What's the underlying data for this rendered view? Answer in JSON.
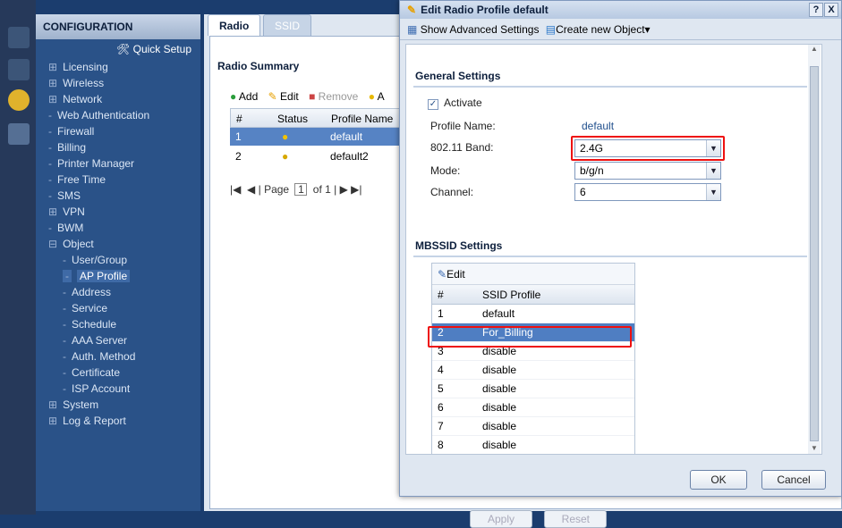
{
  "nav": {
    "header": "CONFIGURATION",
    "quick_setup": "Quick Setup",
    "items": [
      {
        "label": "Licensing",
        "prefix": "⊞"
      },
      {
        "label": "Wireless",
        "prefix": "⊞"
      },
      {
        "label": "Network",
        "prefix": "⊞"
      },
      {
        "label": "Web Authentication",
        "prefix": "-"
      },
      {
        "label": "Firewall",
        "prefix": "-"
      },
      {
        "label": "Billing",
        "prefix": "-"
      },
      {
        "label": "Printer Manager",
        "prefix": "-"
      },
      {
        "label": "Free Time",
        "prefix": "-"
      },
      {
        "label": "SMS",
        "prefix": "-"
      },
      {
        "label": "VPN",
        "prefix": "⊞"
      },
      {
        "label": "BWM",
        "prefix": "-"
      },
      {
        "label": "Object",
        "prefix": "⊟"
      },
      {
        "label": "User/Group",
        "prefix": "-"
      },
      {
        "label": "AP Profile",
        "prefix": "-"
      },
      {
        "label": "Address",
        "prefix": "-"
      },
      {
        "label": "Service",
        "prefix": "-"
      },
      {
        "label": "Schedule",
        "prefix": "-"
      },
      {
        "label": "AAA Server",
        "prefix": "-"
      },
      {
        "label": "Auth. Method",
        "prefix": "-"
      },
      {
        "label": "Certificate",
        "prefix": "-"
      },
      {
        "label": "ISP Account",
        "prefix": "-"
      },
      {
        "label": "System",
        "prefix": "⊞"
      },
      {
        "label": "Log & Report",
        "prefix": "⊞"
      }
    ]
  },
  "main": {
    "tabs": [
      "Radio",
      "SSID"
    ],
    "summary_title": "Radio Summary",
    "toolbar": {
      "add": "Add",
      "edit": "Edit",
      "remove": "Remove",
      "more": "A"
    },
    "columns": [
      "#",
      "Status",
      "Profile Name"
    ],
    "rows": [
      {
        "num": "1",
        "name": "default"
      },
      {
        "num": "2",
        "name": "default2"
      }
    ],
    "pager": {
      "page_label": "Page",
      "page": "1",
      "of": "of 1"
    },
    "apply": "Apply",
    "reset": "Reset"
  },
  "dialog": {
    "title": "Edit Radio Profile default",
    "help": "?",
    "close": "X",
    "show_advanced": "Show Advanced Settings",
    "create_new": "Create new Object",
    "general_title": "General Settings",
    "activate": "Activate",
    "profile_name_label": "Profile Name:",
    "profile_name_value": "default",
    "band_label": "802.11 Band:",
    "band_value": "2.4G",
    "mode_label": "Mode:",
    "mode_value": "b/g/n",
    "channel_label": "Channel:",
    "channel_value": "6",
    "mbssid_title": "MBSSID Settings",
    "mbssid_edit": "Edit",
    "mbssid_columns": [
      "#",
      "SSID Profile"
    ],
    "mbssid_rows": [
      {
        "num": "1",
        "profile": "default"
      },
      {
        "num": "2",
        "profile": "For_Billing"
      },
      {
        "num": "3",
        "profile": "disable"
      },
      {
        "num": "4",
        "profile": "disable"
      },
      {
        "num": "5",
        "profile": "disable"
      },
      {
        "num": "6",
        "profile": "disable"
      },
      {
        "num": "7",
        "profile": "disable"
      },
      {
        "num": "8",
        "profile": "disable"
      }
    ],
    "ok": "OK",
    "cancel": "Cancel"
  }
}
